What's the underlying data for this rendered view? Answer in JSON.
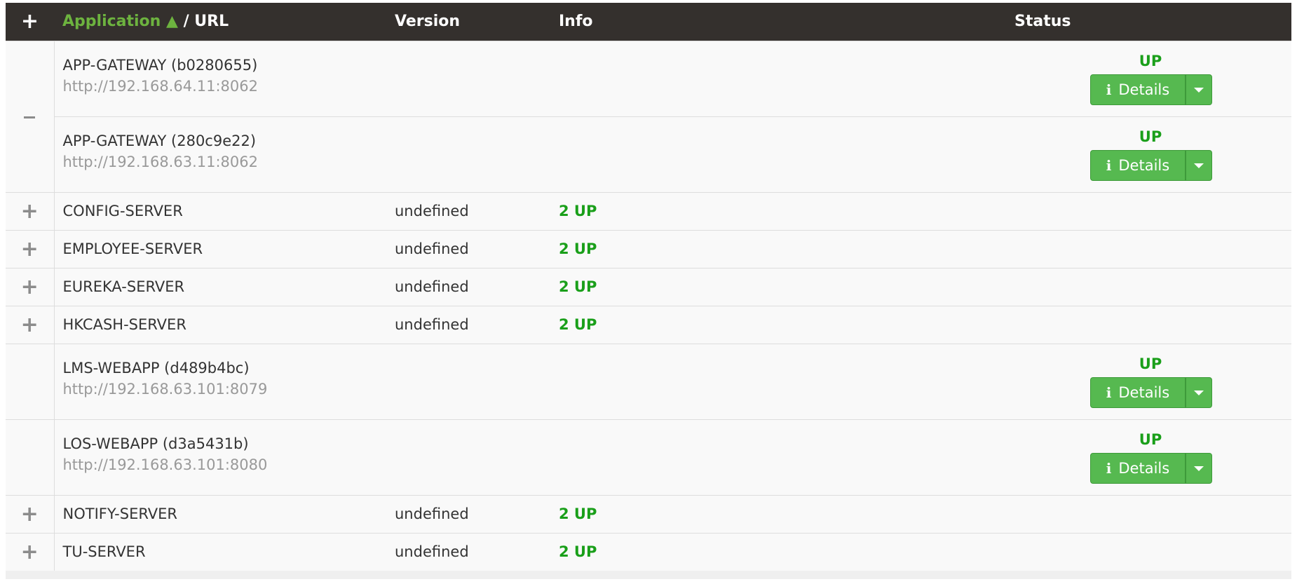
{
  "header": {
    "toggle_icon": "plus-icon",
    "application_label": "Application",
    "sort_indicator": "▲",
    "url_label": "/ URL",
    "version_label": "Version",
    "info_label": "Info",
    "status_label": "Status"
  },
  "groups": {
    "app_gateway": {
      "toggle_icon": "minus-icon",
      "instances": [
        {
          "name": "APP-GATEWAY (b0280655)",
          "url": "http://192.168.64.11:8062",
          "status": "UP",
          "details_label": "Details"
        },
        {
          "name": "APP-GATEWAY (280c9e22)",
          "url": "http://192.168.63.11:8062",
          "status": "UP",
          "details_label": "Details"
        }
      ]
    },
    "collapsed_top": [
      {
        "name": "CONFIG-SERVER",
        "version": "undefined",
        "info": "2 UP"
      },
      {
        "name": "EMPLOYEE-SERVER",
        "version": "undefined",
        "info": "2 UP"
      },
      {
        "name": "EUREKA-SERVER",
        "version": "undefined",
        "info": "2 UP"
      },
      {
        "name": "HKCASH-SERVER",
        "version": "undefined",
        "info": "2 UP"
      }
    ],
    "single_instances": [
      {
        "name": "LMS-WEBAPP (d489b4bc)",
        "url": "http://192.168.63.101:8079",
        "status": "UP",
        "details_label": "Details"
      },
      {
        "name": "LOS-WEBAPP (d3a5431b)",
        "url": "http://192.168.63.101:8080",
        "status": "UP",
        "details_label": "Details"
      }
    ],
    "collapsed_bottom": [
      {
        "name": "NOTIFY-SERVER",
        "version": "undefined",
        "info": "2 UP"
      },
      {
        "name": "TU-SERVER",
        "version": "undefined",
        "info": "2 UP"
      }
    ]
  },
  "colors": {
    "header_bg": "#34302d",
    "sort_active": "#6db33f",
    "status_up": "#1a9f1a",
    "button_green": "#56b950"
  }
}
